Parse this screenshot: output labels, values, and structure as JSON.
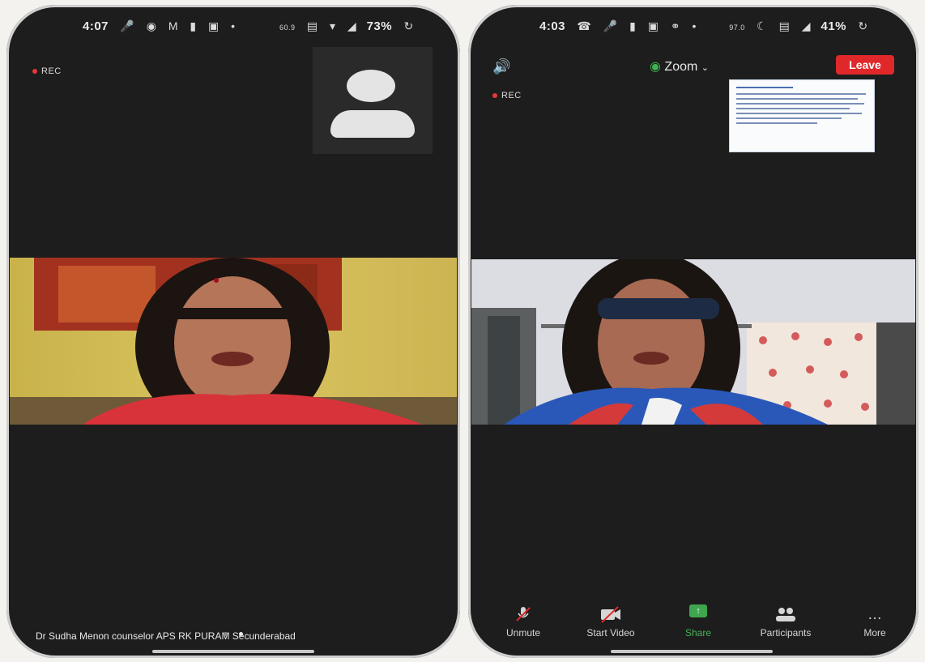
{
  "left_phone": {
    "status": {
      "time": "4:07",
      "battery": "73%",
      "net_speed": "60.9"
    },
    "rec_label": "REC",
    "caption": "Dr Sudha Menon counselor APS RK PURAM Secunderabad"
  },
  "right_phone": {
    "status": {
      "time": "4:03",
      "battery": "41%",
      "net_speed": "97.0"
    },
    "rec_label": "REC",
    "app_title": "Zoom",
    "leave_label": "Leave",
    "toolbar": {
      "unmute": "Unmute",
      "start_video": "Start Video",
      "share": "Share",
      "participants": "Participants",
      "more": "More"
    }
  },
  "colors": {
    "leave": "#e0282b",
    "share": "#3fa64f",
    "rec_dot": "#e53935"
  },
  "icons": [
    "mic-icon",
    "camera-icon",
    "image-icon",
    "wifi-icon",
    "signal-icon",
    "speaker-icon",
    "shield-icon",
    "chevron-down-icon",
    "mic-muted-icon",
    "video-off-icon",
    "share-icon",
    "participants-icon",
    "more-icon",
    "whatsapp-icon"
  ]
}
